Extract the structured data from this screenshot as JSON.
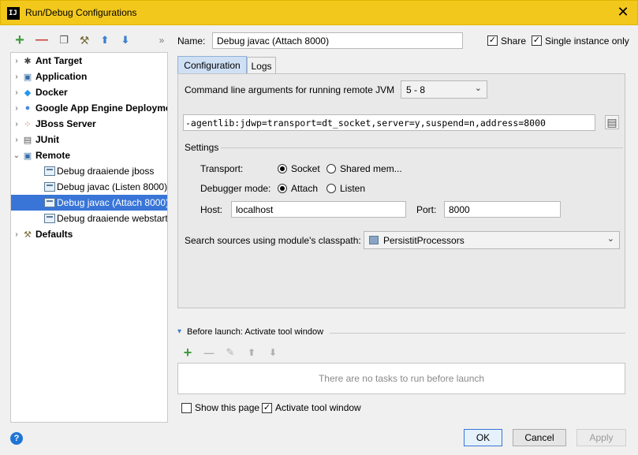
{
  "window": {
    "title": "Run/Debug Configurations",
    "logo_text": "IJ",
    "close_glyph": "✕"
  },
  "toolbar": {
    "icons": [
      "add-icon",
      "remove-icon",
      "copy-icon",
      "wrench-icon",
      "move-up-icon",
      "move-down-icon",
      "expand-more-icon"
    ],
    "glyphs": {
      "add": "+",
      "remove": "—",
      "copy": "❐",
      "wrench": "⚒",
      "up": "⬆",
      "down": "⬇",
      "more": "»"
    }
  },
  "tree": {
    "items": [
      {
        "label": "Ant Target",
        "arrow": "›",
        "icon": "ant-icon",
        "glyph": "✱"
      },
      {
        "label": "Application",
        "arrow": "›",
        "icon": "application-icon",
        "glyph": "▣"
      },
      {
        "label": "Docker",
        "arrow": "›",
        "icon": "docker-icon",
        "glyph": "◆"
      },
      {
        "label": "Google App Engine Deployme",
        "arrow": "›",
        "icon": "google-app-engine-icon",
        "glyph": "●"
      },
      {
        "label": "JBoss Server",
        "arrow": "›",
        "icon": "jboss-icon",
        "glyph": "⁘"
      },
      {
        "label": "JUnit",
        "arrow": "›",
        "icon": "junit-icon",
        "glyph": "▤"
      },
      {
        "label": "Remote",
        "arrow": "⌄",
        "icon": "remote-icon",
        "glyph": "▣"
      }
    ],
    "children": [
      {
        "label": "Debug draaiende jboss"
      },
      {
        "label": "Debug javac (Listen 8000)"
      },
      {
        "label": "Debug javac (Attach 8000)",
        "selected": true
      },
      {
        "label": "Debug draaiende webstart-"
      }
    ],
    "defaults": {
      "label": "Defaults",
      "arrow": "›",
      "icon": "defaults-wrench-icon",
      "glyph": "⚒"
    }
  },
  "config": {
    "name_label": "Name:",
    "name_value": "Debug javac (Attach 8000)",
    "share_label": "Share",
    "share_checked": "✓",
    "single_instance_label": "Single instance only",
    "single_instance_checked": "✓",
    "tabs": [
      {
        "label": "Configuration",
        "active": true
      },
      {
        "label": "Logs",
        "active": false
      }
    ],
    "cmd_args_label": "Command line arguments for running remote JVM",
    "jvm_version": "5 - 8",
    "jvm_args": "-agentlib:jdwp=transport=dt_socket,server=y,suspend=n,address=8000",
    "copy_icon_glyph": "▤",
    "settings_label": "Settings",
    "transport_label": "Transport:",
    "transport_options": [
      {
        "label": "Socket",
        "selected": true
      },
      {
        "label": "Shared mem...",
        "selected": false
      }
    ],
    "debugger_mode_label": "Debugger mode:",
    "debugger_mode_options": [
      {
        "label": "Attach",
        "selected": true
      },
      {
        "label": "Listen",
        "selected": false
      }
    ],
    "host_label": "Host:",
    "host_value": "localhost",
    "port_label": "Port:",
    "port_value": "8000",
    "search_sources_label": "Search sources using module's classpath:",
    "module_value": "PersistitProcessors",
    "chevron_glyph": "⌄"
  },
  "before_launch": {
    "title": "Before launch: Activate tool window",
    "toggle_glyph": "▾",
    "empty_text": "There are no tasks to run before launch",
    "toolbar_glyphs": {
      "add": "+",
      "remove": "—",
      "edit": "✎",
      "up": "⬆",
      "down": "⬇"
    },
    "show_this_page_label": "Show this page",
    "show_this_page_checked": "",
    "activate_tool_window_label": "Activate tool window",
    "activate_tool_window_checked": "✓"
  },
  "footer": {
    "help_glyph": "?",
    "ok_label": "OK",
    "cancel_label": "Cancel",
    "apply_label": "Apply"
  },
  "colors": {
    "titlebar": "#f3c81c",
    "selection": "#3875d7",
    "add_green": "#3f9b3f",
    "remove_red": "#c8403c",
    "arrow_blue": "#3c7fd1"
  }
}
